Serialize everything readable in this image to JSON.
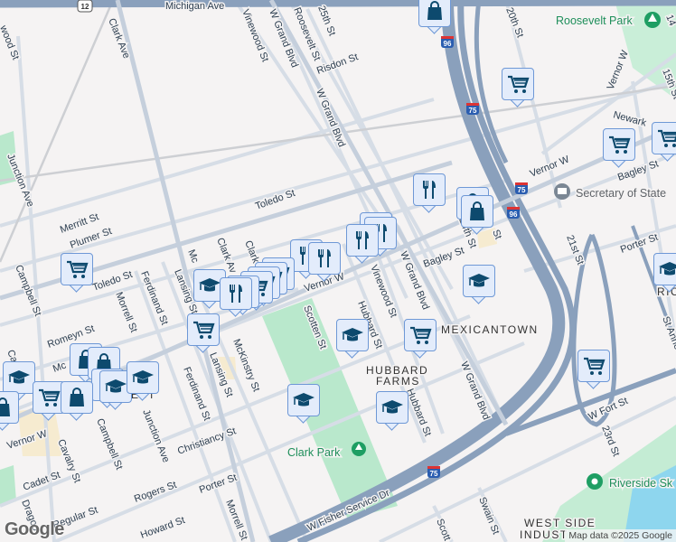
{
  "colors": {
    "freeway": "#8aa0bc",
    "street": "#d8dee6",
    "park": "#b9e8cc",
    "water": "#8ed6ee",
    "marker_fill": "#e3ecfb",
    "marker_border": "#6e98d6",
    "icon": "#0d4a6e"
  },
  "streets": {
    "michigan": "Michigan Ave",
    "us12": "12",
    "clark_ave": "Clark Ave",
    "clark_ave2": "Clark Av",
    "clark_st": "Clark",
    "vinewood": "Vinewood St",
    "vinewood_w": "wood St",
    "w_grand_1": "W Grand Blvd",
    "w_grand_2": "W Grand Blvd",
    "w_grand_3": "W Grand Blvd",
    "w_grand_4": "W Grand Blvd",
    "roosevelt": "Roosevelt St",
    "st25": "25th St",
    "risdon": "Risdon St",
    "junction": "Junction Ave",
    "junction2": "Junction Ave",
    "merritt": "Merritt St",
    "plumer": "Plumer St",
    "toledo": "Toledo St",
    "toledo2": "Toledo St",
    "campbell": "Campbell St",
    "campbell2": "Campbell St",
    "morrell": "Morrell St",
    "morrell2": "Morrell St",
    "ferdinand": "Ferdinand St",
    "ferdinand2": "Ferdinand St",
    "lansing": "Lansing St",
    "lansing2": "Lansing St",
    "mck": "Mc",
    "mckinstry": "McKinstry St",
    "romeyn": "Romeyn St",
    "mc2": "Mc",
    "vernor_w": "Vernor W",
    "vernor_w2": "Vernor W",
    "vernor_w3": "Vernor W",
    "vernor_w4": "Vernor W",
    "cavalry": "Cavalry St",
    "cadet": "Cadet St",
    "regular": "Regular St",
    "dragoon": "Dragoo",
    "rogers": "Rogers St",
    "howard": "Howard St",
    "christiancy": "Christiancy St",
    "porter": "Porter St",
    "porter2": "Porter St",
    "scotten": "Scotten St",
    "scotten2": "Scott",
    "hubbard": "Hubbard St",
    "hubbard2": "Hubbard St",
    "vinewood2": "Vinewood St",
    "bagley": "Bagley St",
    "bagley2": "Bagley St",
    "st24": "24th St",
    "st20": "20th St",
    "st21": "21st St",
    "st23": "23rd St",
    "st15": "15th St",
    "st14": "14",
    "newark": "Newark",
    "fort": "W Fort St",
    "fisher": "W Fisher Service Dr",
    "swain": "Swain St",
    "st_anne": "St Anne S",
    "i75a": "75",
    "i75b": "75",
    "i75c": "75",
    "i96a": "96",
    "i96b": "96",
    "st_cut": "St",
    "c_cut": "Ca"
  },
  "neighborhoods": {
    "mexicantown": "MEXICANTOWN",
    "hubbard_farms": "HUBBARD",
    "hubbard_farms2": "FARMS",
    "west_side": "WEST SIDE",
    "west_side2": "INDUST",
    "est": "EST",
    "ric": "RIC"
  },
  "places": {
    "clark_park": "Clark Park",
    "roosevelt_park": "Roosevelt Park",
    "sos": "Secretary of State",
    "riverside": "Riverside Sk"
  },
  "branding": {
    "logo": "Google",
    "attribution": "Map data ©2025 Google"
  },
  "markers": [
    {
      "icon": "shopping-bag-icon"
    },
    {
      "icon": "shopping-cart-icon"
    },
    {
      "icon": "shopping-cart-icon"
    },
    {
      "icon": "shopping-cart-icon"
    },
    {
      "icon": "restaurant-icon"
    },
    {
      "icon": "shopping-bag-icon"
    },
    {
      "icon": "shopping-bag-icon"
    },
    {
      "icon": "restaurant-icon"
    },
    {
      "icon": "restaurant-icon"
    },
    {
      "icon": "restaurant-icon"
    },
    {
      "icon": "restaurant-icon"
    },
    {
      "icon": "restaurant-icon"
    },
    {
      "icon": "shopping-cart-icon"
    },
    {
      "icon": "shopping-cart-icon"
    },
    {
      "icon": "shopping-cart-icon"
    },
    {
      "icon": "shopping-cart-icon"
    },
    {
      "icon": "graduation-cap-icon"
    },
    {
      "icon": "restaurant-icon"
    },
    {
      "icon": "restaurant-icon"
    },
    {
      "icon": "shopping-cart-icon"
    },
    {
      "icon": "shopping-cart-icon"
    },
    {
      "icon": "graduation-cap-icon"
    },
    {
      "icon": "shopping-cart-icon"
    },
    {
      "icon": "graduation-cap-icon"
    },
    {
      "icon": "graduation-cap-icon"
    },
    {
      "icon": "graduation-cap-icon"
    },
    {
      "icon": "shopping-cart-icon"
    },
    {
      "icon": "graduation-cap-icon"
    },
    {
      "icon": "shopping-bag-icon"
    },
    {
      "icon": "shopping-bag-icon"
    },
    {
      "icon": "shopping-bag-icon"
    },
    {
      "icon": "graduation-cap-icon"
    },
    {
      "icon": "graduation-cap-icon"
    },
    {
      "icon": "graduation-cap-icon"
    },
    {
      "icon": "shopping-cart-icon"
    },
    {
      "icon": "shopping-bag-icon"
    },
    {
      "icon": "shopping-bag-icon"
    }
  ]
}
